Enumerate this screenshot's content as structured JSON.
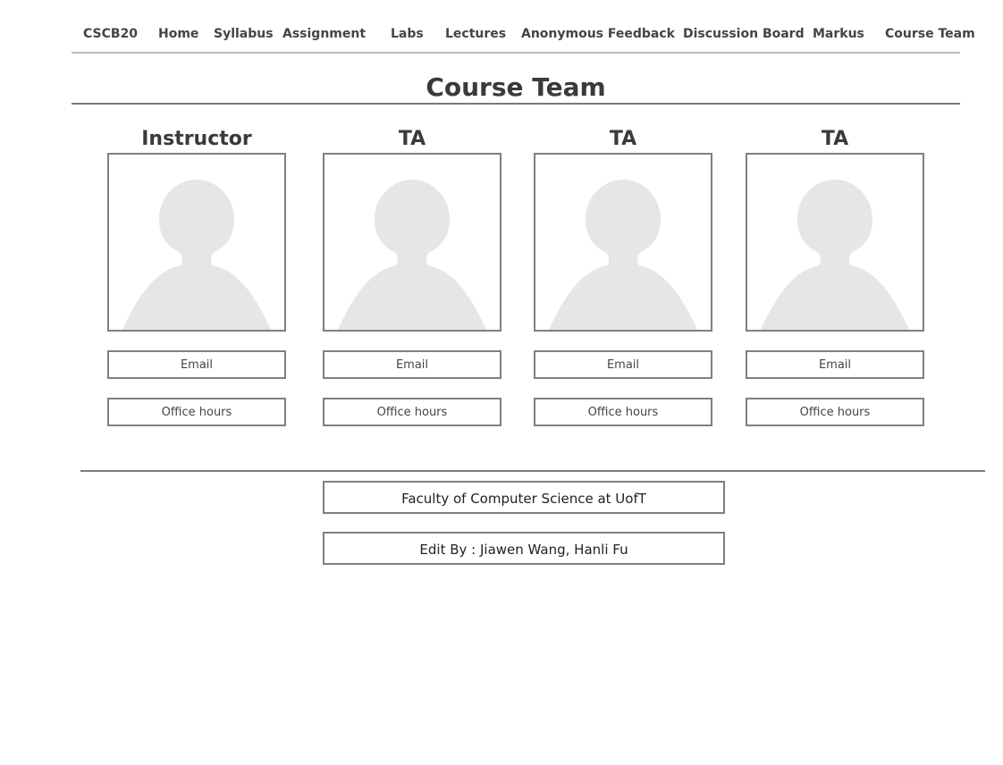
{
  "nav": {
    "items": [
      {
        "label": "CSCB20"
      },
      {
        "label": "Home"
      },
      {
        "label": "Syllabus"
      },
      {
        "label": "Assignment"
      },
      {
        "label": "Labs"
      },
      {
        "label": "Lectures"
      },
      {
        "label": "Anonymous Feedback"
      },
      {
        "label": "Discussion Board"
      },
      {
        "label": "Markus"
      },
      {
        "label": "Course Team"
      }
    ]
  },
  "page": {
    "title": "Course Team"
  },
  "team": [
    {
      "role": "Instructor",
      "email": "Email",
      "hours": "Office hours"
    },
    {
      "role": "TA",
      "email": "Email",
      "hours": "Office hours"
    },
    {
      "role": "TA",
      "email": "Email",
      "hours": "Office hours"
    },
    {
      "role": "TA",
      "email": "Email",
      "hours": "Office hours"
    }
  ],
  "footer": {
    "faculty": "Faculty of Computer Science at UofT",
    "editors": "Edit By : Jiawen Wang, Hanli Fu"
  },
  "icons": {
    "avatar": "person-silhouette-icon"
  },
  "colors": {
    "border": "#7f7f7f",
    "silhouette": "#e6e6e6",
    "text": "#333333"
  }
}
